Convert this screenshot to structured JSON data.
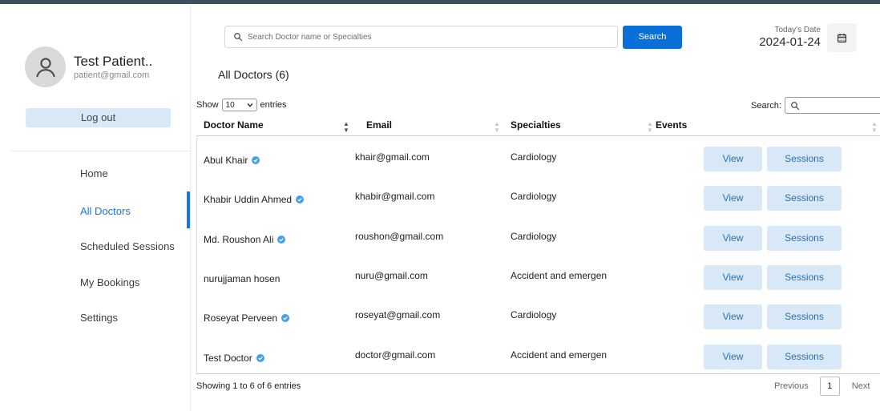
{
  "user": {
    "name": "Test Patient..",
    "email": "patient@gmail.com"
  },
  "sidebar": {
    "logout_label": "Log out",
    "items": [
      {
        "label": "Home",
        "active": false
      },
      {
        "label": "All Doctors",
        "active": true
      },
      {
        "label": "Scheduled Sessions",
        "active": false
      },
      {
        "label": "My Bookings",
        "active": false
      },
      {
        "label": "Settings",
        "active": false
      }
    ]
  },
  "header": {
    "search_placeholder": "Search Doctor name or Specialties",
    "search_button": "Search",
    "date_label": "Today's Date",
    "date_value": "2024-01-24"
  },
  "page": {
    "title": "All Doctors (6)"
  },
  "table_controls": {
    "show_prefix": "Show",
    "show_value": "10",
    "show_suffix": "entries",
    "search_label": "Search:"
  },
  "table": {
    "columns": [
      "Doctor Name",
      "Email",
      "Specialties",
      "Events"
    ],
    "rows": [
      {
        "name": "Abul Khair",
        "verified": true,
        "email": "khair@gmail.com",
        "specialty": "Cardiology"
      },
      {
        "name": "Khabir Uddin Ahmed",
        "verified": true,
        "email": "khabir@gmail.com",
        "specialty": "Cardiology"
      },
      {
        "name": "Md. Roushon Ali",
        "verified": true,
        "email": "roushon@gmail.com",
        "specialty": "Cardiology"
      },
      {
        "name": "nurujjaman hosen",
        "verified": false,
        "email": "nuru@gmail.com",
        "specialty": "Accident and emergen"
      },
      {
        "name": "Roseyat Perveen",
        "verified": true,
        "email": "roseyat@gmail.com",
        "specialty": "Cardiology"
      },
      {
        "name": "Test Doctor",
        "verified": true,
        "email": "doctor@gmail.com",
        "specialty": "Accident and emergen"
      }
    ],
    "view_label": "View",
    "sessions_label": "Sessions"
  },
  "footer": {
    "info": "Showing 1 to 6 of 6 entries",
    "previous": "Previous",
    "current_page": "1",
    "next": "Next"
  },
  "colors": {
    "accent": "#1a73e8",
    "button_primary": "#0a6fd6",
    "button_soft": "#d8e8f6",
    "verified_badge": "#4a9fe8"
  }
}
